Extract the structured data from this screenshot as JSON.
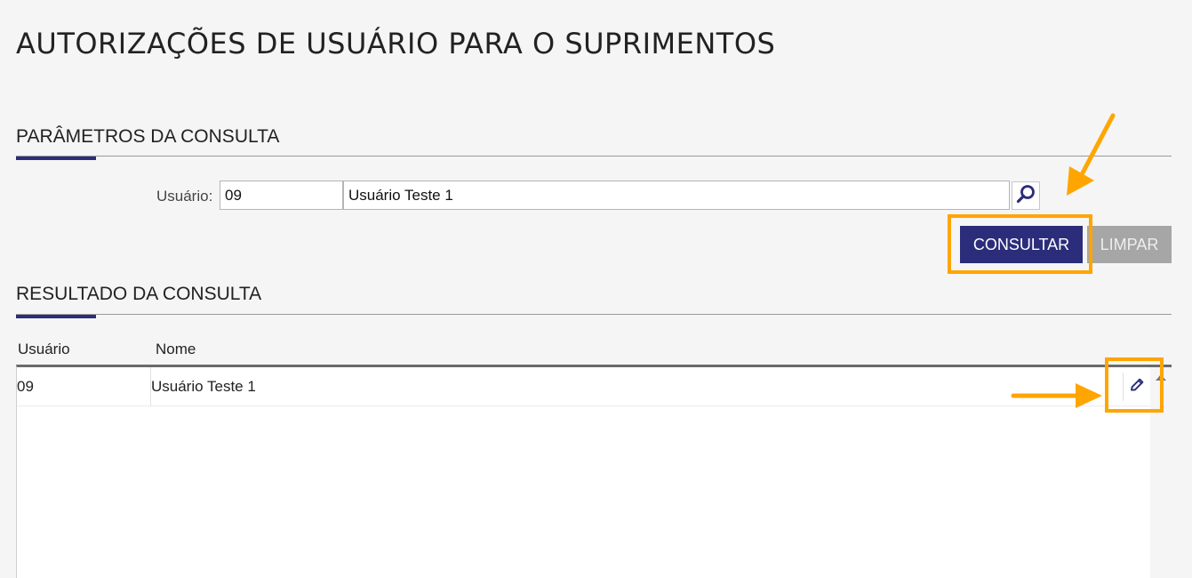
{
  "page": {
    "title": "AUTORIZAÇÕES DE USUÁRIO PARA O SUPRIMENTOS"
  },
  "params": {
    "section_title": "PARÂMETROS DA CONSULTA",
    "user_label": "Usuário:",
    "user_code": "09",
    "user_name": "Usuário Teste 1",
    "search_icon": "magnifier-icon"
  },
  "actions": {
    "consult_label": "CONSULTAR",
    "clear_label": "LIMPAR"
  },
  "results": {
    "section_title": "RESULTADO DA CONSULTA",
    "columns": [
      "Usuário",
      "Nome"
    ],
    "rows": [
      {
        "usuario": "09",
        "nome": "Usuário Teste 1",
        "action_icon": "pencil-icon"
      }
    ]
  },
  "colors": {
    "primary": "#2b2d7a",
    "secondary": "#a6a6a6",
    "annotation": "#ffa500"
  }
}
